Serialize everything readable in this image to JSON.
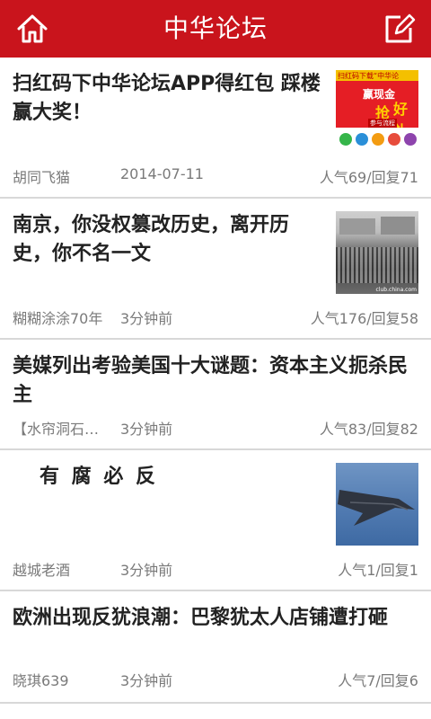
{
  "header": {
    "title": "中华论坛"
  },
  "posts": [
    {
      "title": "扫红码下中华论坛APP得红包  踩楼赢大奖！",
      "author": "胡同飞猫",
      "time": "2014-07-11",
      "stats": "人气69/回复71"
    },
    {
      "title": "南京，你没权篡改历史，离开历史，你不名一文",
      "author": "糊糊涂涂70年",
      "time": "3分钟前",
      "stats": "人气176/回复58"
    },
    {
      "title": "美媒列出考验美国十大谜题：资本主义扼杀民主",
      "author": "【水帘洞石…",
      "time": "3分钟前",
      "stats": "人气83/回复82"
    },
    {
      "title": "有 腐 必 反",
      "author": "越城老酒",
      "time": "3分钟前",
      "stats": "人气1/回复1"
    },
    {
      "title": "欧洲出现反犹浪潮：巴黎犹太人店铺遭打砸",
      "author": "晓琪639",
      "time": "3分钟前",
      "stats": "人气7/回复6"
    }
  ],
  "thumb1": {
    "l1": "扫红码下载“中华论",
    "l2": "赢现金",
    "l3": "抢",
    "l4": "好礼",
    "l5": "参与流程"
  },
  "thumb2": {
    "caption": "club.china.com"
  },
  "colors": {
    "header": "#c9141c",
    "divider": "#d8d8d8"
  }
}
